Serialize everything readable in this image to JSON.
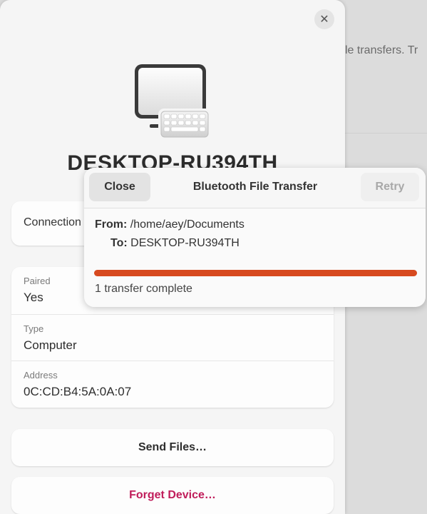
{
  "background": {
    "text": "le transfers. Tr"
  },
  "device": {
    "name": "DESKTOP-RU394TH",
    "icon": "computer-keyboard-icon",
    "close_icon": "✕",
    "connection_label": "Connection",
    "details": [
      {
        "key": "Paired",
        "value": "Yes"
      },
      {
        "key": "Type",
        "value": "Computer"
      },
      {
        "key": "Address",
        "value": "0C:CD:B4:5A:0A:07"
      }
    ],
    "send_label": "Send Files…",
    "forget_label": "Forget Device…",
    "forget_color": "#c01c5a"
  },
  "transfer": {
    "title": "Bluetooth File Transfer",
    "close_label": "Close",
    "retry_label": "Retry",
    "from_label": "From:",
    "from_value": "/home/aey/Documents",
    "to_label": "To:",
    "to_value": "DESKTOP-RU394TH",
    "progress": 1.0,
    "progress_color": "#d74a1f",
    "status": "1 transfer complete"
  }
}
